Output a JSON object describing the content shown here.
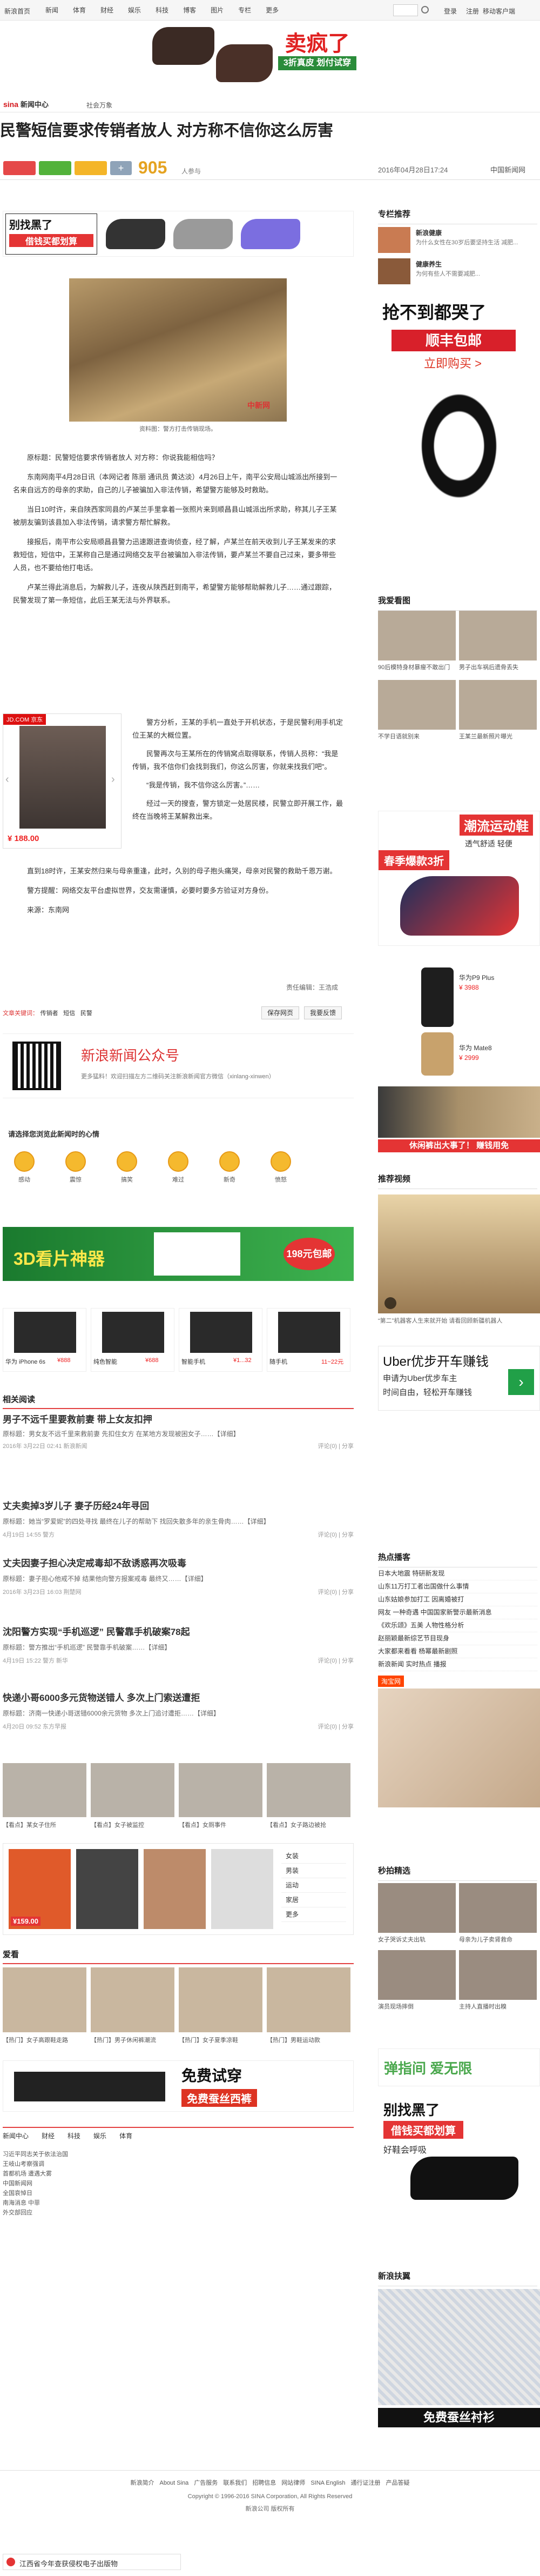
{
  "topbar": {
    "brand": "新浪首页",
    "nav": [
      "新闻",
      "体育",
      "财经",
      "娱乐",
      "科技",
      "博客",
      "图片",
      "专栏",
      "更多"
    ],
    "search_placeholder": "搜索",
    "login": "登录",
    "register": "注册",
    "mobile": "移动客户端"
  },
  "banner_ad": {
    "main": "卖疯了",
    "sub": "3折真皮",
    "tag": "划付试穿"
  },
  "channel": {
    "logo": "新闻中心",
    "crumb": "社会万象"
  },
  "article": {
    "title": "民警短信要求传销者放人 对方称不信你这么厉害",
    "share_count": "905",
    "share_unit": "人参与",
    "date": "2016年04月28日17:24",
    "source": "中国新闻网",
    "figure_caption": "资料图：警方打击传销现场。",
    "paragraphs": [
      "原标题：民警短信要求传销者放人 对方称：你说我能相信吗？",
      "东南网南平4月28日讯（本网记者 陈丽 通讯员 黄达淡）4月26日上午，南平公安局山城派出所接到一名来自远方的母亲的求助，自己的儿子被骗加入非法传销，希望警方能够及时救助。",
      "当日10时许，来自陕西家同县的卢某兰手里拿着一张照片来到顺昌县山城派出所求助，称其儿子王某被朋友骗到该县加入非法传销，请求警方帮忙解救。",
      "接报后，南平市公安局顺昌县警力迅速跟进查询侦查，经了解，卢某兰在前天收到儿子王某发来的求救短信，短信中，王某称自己是通过网络交友平台被骗加入非法传销，要卢某兰不要自己过来，要多带些人员，也不要给他打电话。",
      "卢某兰得此消息后，为解救儿子，连夜从陕西赶到南平，希望警方能够帮助解救儿子……通过跟踪，民警发现了第一条短信，此后王某无法与外界联系。",
      "警方分析，王某的手机一直处于开机状态，于是民警利用手机定位王某的大概位置。",
      "民警再次与王某所在的传销窝点取得联系，传销人员称：“我是传销，我不信你们会找到我们，你这么厉害，你就来找我们吧”。",
      "“我是传销，我不信你这么厉害。”……",
      "经过一天的搜查，警方锁定一处居民楼，民警立即开展工作，最终在当晚将王某解救出来。",
      "直到18时许，王某安然归来与母亲重逢，此时，久别的母子抱头痛哭，母亲对民警的救助千恩万谢。",
      "警方提醒：网络交友平台虚拟世界，交友需谨慎，必要时要多方验证对方身份。"
    ],
    "source_line": "来源：东南网",
    "editor": "责任编辑：王浩成",
    "tags": [
      "传销者",
      "短信",
      "民警"
    ],
    "tag_label": "文章关键词：",
    "actions": [
      "保存网页",
      "我要反馈"
    ]
  },
  "product_ad": {
    "shop": "JD.COM 京东",
    "price": "¥ 188.00"
  },
  "wechat": {
    "title": "新浪新闻公众号",
    "desc": "更多猛料！欢迎扫描左方二维码关注新浪新闻官方微信（xinlang-xinwen）"
  },
  "emotion": {
    "title": "请选择您浏览此新闻时的心情",
    "items": [
      {
        "label": "感动"
      },
      {
        "label": "震惊"
      },
      {
        "label": "搞笑"
      },
      {
        "label": "难过"
      },
      {
        "label": "新奇"
      },
      {
        "label": "愤怒"
      }
    ]
  },
  "vr_ad": {
    "headline": "3D看片神器",
    "badge": "198元包邮"
  },
  "phone_ad": {
    "items": [
      {
        "label": "华为 iPhone 6s",
        "price": "¥888"
      },
      {
        "label": "纯色智能",
        "price": "¥688"
      },
      {
        "label": "智能手机 ",
        "price": "¥1...32"
      },
      {
        "label": "随手机",
        "price": "11~22元"
      }
    ]
  },
  "related": {
    "title": "相关阅读",
    "items": [
      {
        "headline": "男子不远千里要救前妻 带上女友扣押",
        "summary": "原标题：男女友不远千里来救前妻 先扣住女方 在某地方发现被困女子……【详细】",
        "meta": "2016年 3月22日 02:41",
        "source": "新浪新闻",
        "comments": "评论(0)",
        "share": "分享"
      },
      {
        "headline": "丈夫卖掉3岁儿子 妻子历经24年寻回",
        "summary": "原标题：她当“罗爱妮”的四处寻找 最终在儿子的帮助下 找回失散多年的亲生骨肉……【详细】",
        "meta": "4月19日 14:55",
        "source": "警方",
        "comments": "评论(0)",
        "share": "分享"
      },
      {
        "headline": "丈夫因妻子担心决定戒毒却不敌诱惑再次吸毒",
        "summary": "原标题：妻子担心他戒不掉 结果他向警方报案戒毒 最终又……【详细】",
        "meta": "2016年 3月23日 16:03",
        "source": "荆楚网",
        "comments": "评论(0)",
        "share": "分享"
      },
      {
        "headline": "沈阳警方实现“手机巡逻” 民警靠手机破案78起",
        "summary": "原标题：警方推出“手机巡逻” 民警靠手机破案……【详细】",
        "meta": "4月19日 15:22",
        "source": "警方 新华",
        "comments": "评论(0)",
        "share": "分享"
      },
      {
        "headline": "快递小哥6000多元货物送错人 多次上门索送遭拒",
        "summary": "原标题：济南一快递小哥送错6000余元货物 多次上门追讨遭拒……【详细】",
        "meta": "4月20日 09:52",
        "source": "东方早报",
        "comments": "评论(0)",
        "share": "分享"
      }
    ]
  },
  "photo_row": [
    "【看点】某女子住所",
    "【看点】女子被监控",
    "【看点】女厕事件",
    "【看点】女子路边被抢"
  ],
  "shop_box": {
    "price": "¥159.00",
    "tabs": [
      "女装",
      "男装",
      "运动",
      "家居",
      "更多"
    ]
  },
  "recommend": {
    "title": "爱看",
    "items": [
      "【热门】女子高跟鞋走路",
      "【热门】男子休闲裤潮流",
      "【热门】女子夏季凉鞋",
      "【热门】男鞋运动款"
    ]
  },
  "shoes_ad": {
    "line1": "免费试穿",
    "line2": "免费蚕丝西裤"
  },
  "bottom_links": {
    "tabs": [
      "新闻中心",
      "财经",
      "科技",
      "娱乐",
      "体育"
    ],
    "links": [
      "习近平同志关于依法治国",
      "王岐山考察强调",
      "首都机场 遭遇大雾",
      "中国新闻网",
      "全国哀悼日",
      "南海消息 中菲",
      "外交部回应"
    ]
  },
  "footer": {
    "links": [
      "新浪简介",
      "About Sina",
      "广告服务",
      "联系我们",
      "招聘信息",
      "网站律师",
      "SINA English",
      "通行证注册",
      "产品答疑"
    ],
    "copyright": "Copyright © 1996-2016 SINA Corporation, All Rights Reserved",
    "company": "新浪公司 版权所有"
  },
  "float_bar": {
    "text": "江西省今年查获侵权电子出版物"
  },
  "sidebar": {
    "recommend_title": "专栏推荐",
    "rec_items": [
      {
        "title": "新浪健康",
        "desc": "为什么女性在30岁后要坚持生活 减肥..."
      },
      {
        "title": "健康养生",
        "desc": "为何有些人不需要减肥..."
      }
    ],
    "ad1": {
      "line1": "抢不到都哭了",
      "line2": "顺丰包邮",
      "line3": "立即购买 >"
    },
    "watch_title": "我爱看图",
    "watch_items": [
      "90后模特身材暴瘦不敢出门",
      "男子出车祸后遗骨丢失",
      "不学日语就别来",
      "王某兰最新照片曝光"
    ],
    "sport_ad": {
      "title": "潮流运动鞋",
      "sub": "透气舒适 轻便",
      "tag": "春季爆款3折"
    },
    "phone_list": [
      {
        "name": "华为P9 Plus",
        "price": "¥ 3988"
      },
      {
        "name": "华为 Mate8",
        "price": "¥ 2999"
      }
    ],
    "pants_ad": "休闲裤出大事了！ 赚钱用免",
    "video_title": "推荐视频",
    "video_caption": "“第二”机器客人生来就开始 请看回顾新疆机器人",
    "uber": {
      "line1": "Uber优步开车赚钱",
      "line2": "申请为Uber优步车主",
      "line3": "时间自由，轻松开车赚钱"
    },
    "hot_title": "热点播客",
    "hot_list": [
      "日本大地震 特研新发现",
      "山东11万打工者出国做什么事情",
      "山东姑娘参加打工 因离婚被打",
      "网友 一种奇遇 中国国家新警示最新消息",
      "《欢乐颂》五美 人物性格分析",
      "赵丽颖最新综艺节目现身",
      "大家都来看看 杨幂最新剧照",
      "新浪新闻 实时热点 播报"
    ],
    "taobao_title": "淘宝网",
    "seckill_title": "秒拍精选",
    "seckill_items": [
      "女子哭诉丈夫出轨",
      "母亲为儿子卖肾救命",
      "演员现场摔倒",
      "主持人直播时出糗"
    ],
    "bounce_ad": "弹指间 爱无限",
    "black_ad": {
      "line1": "别找黑了",
      "line2": "借钱买都划算",
      "line3": "好鞋会呼吸"
    },
    "newshop_title": "新浪扶翼",
    "sheep_ad": "免费蚕丝衬衫"
  }
}
